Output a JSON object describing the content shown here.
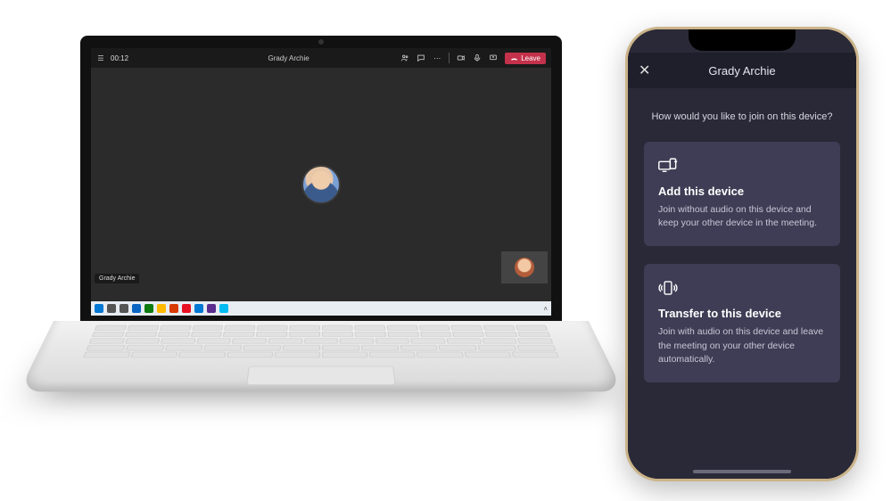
{
  "laptop": {
    "teams": {
      "timer": "00:12",
      "title": "Grady Archie",
      "participant_name": "Grady Archie",
      "leave_label": "Leave",
      "toolbar_icons": [
        "people-icon",
        "chat-icon",
        "more-icon",
        "divider",
        "camera-icon",
        "mic-icon",
        "share-icon"
      ]
    },
    "taskbar_colors": [
      "#0078d4",
      "#555",
      "#555",
      "#0a66c2",
      "#107c10",
      "#ffb900",
      "#d83b01",
      "#e81123",
      "#0078d4",
      "#5b2d90",
      "#00bcf2"
    ]
  },
  "phone": {
    "header_title": "Grady Archie",
    "prompt": "How would you like to join on this device?",
    "cards": [
      {
        "icon": "add-device-icon",
        "title": "Add this device",
        "desc": "Join without audio on this device and keep your other device in the meeting."
      },
      {
        "icon": "transfer-device-icon",
        "title": "Transfer to this device",
        "desc": "Join with audio on this device and leave the meeting on your other device automatically."
      }
    ]
  }
}
